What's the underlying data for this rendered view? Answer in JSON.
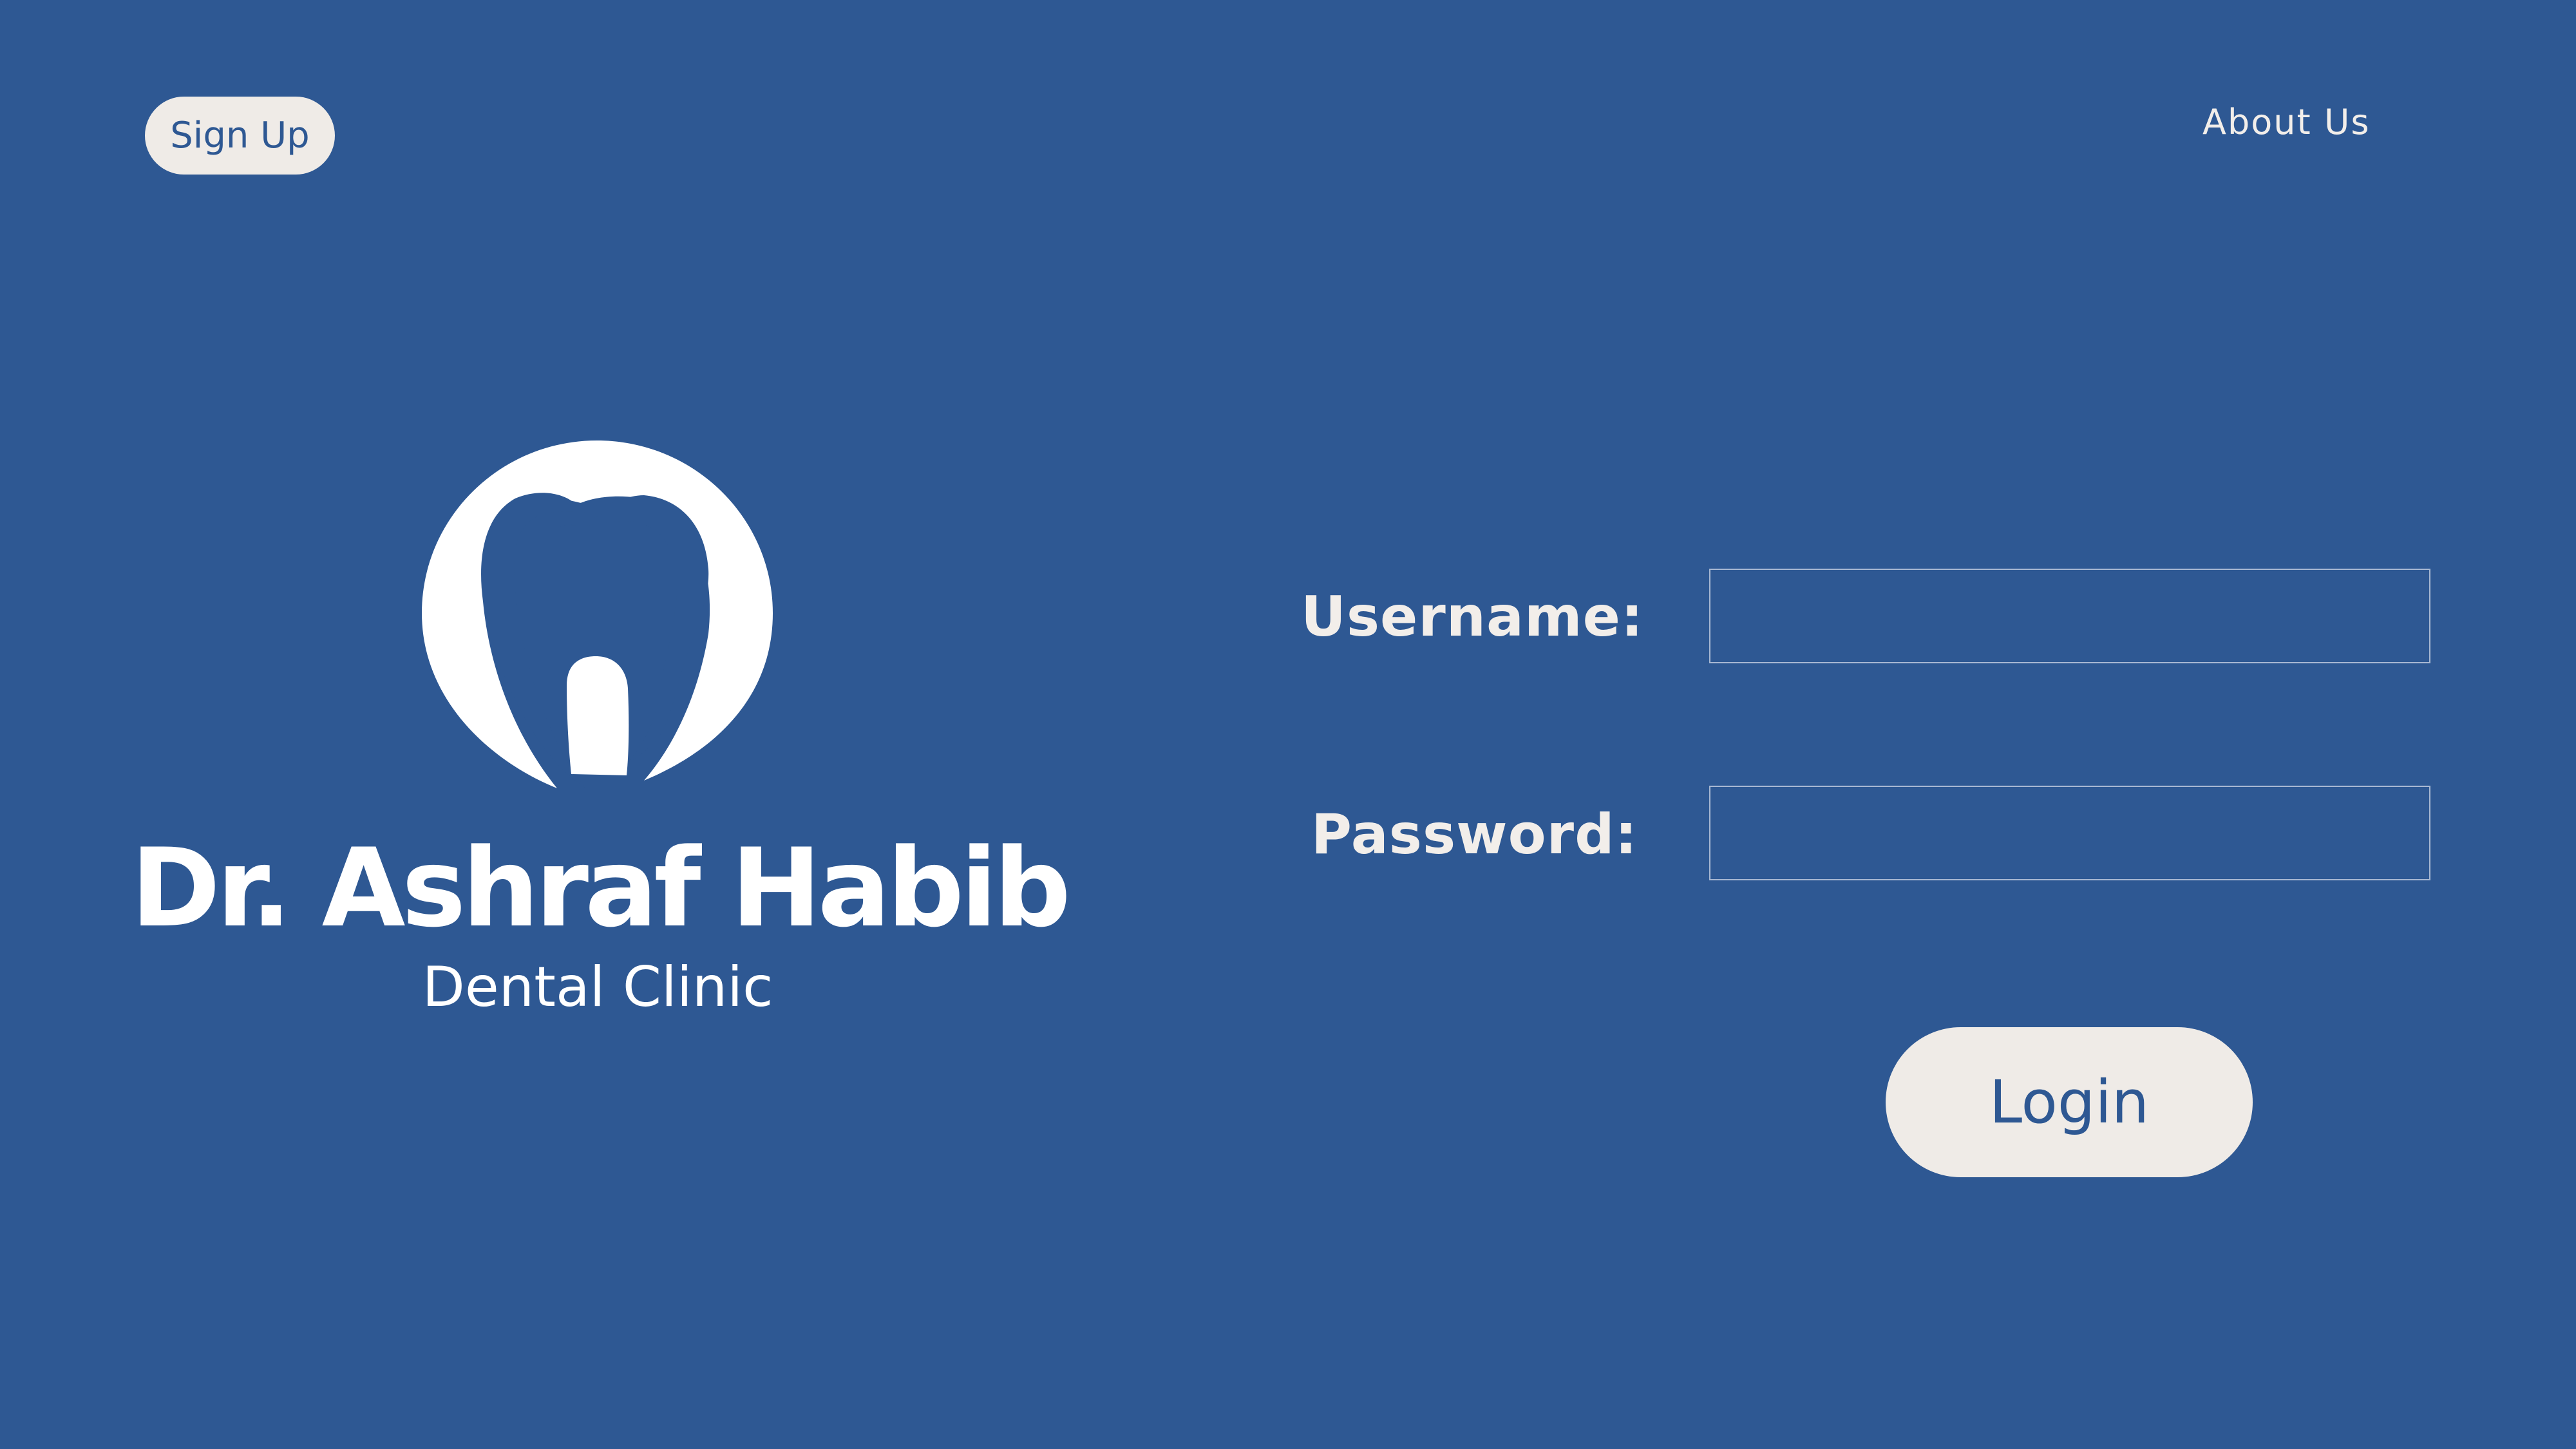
{
  "nav": {
    "signup_label": "Sign Up",
    "about_label": "About Us"
  },
  "brand": {
    "name": "Dr. Ashraf Habib",
    "subtitle": "Dental Clinic",
    "logo_icon": "tooth-logo-icon"
  },
  "login_form": {
    "username_label": "Username:",
    "username_value": "",
    "password_label": "Password:",
    "password_value": "",
    "submit_label": "Login"
  },
  "colors": {
    "background": "#2e5893",
    "button_fill": "#efebe7",
    "button_text": "#2e5893",
    "text": "#f2eeea"
  }
}
